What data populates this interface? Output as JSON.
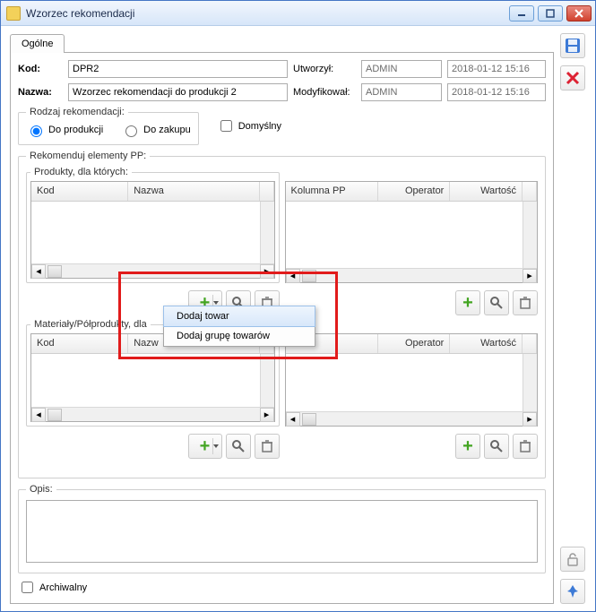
{
  "window": {
    "title": "Wzorzec rekomendacji"
  },
  "tab": {
    "general": "Ogólne"
  },
  "form": {
    "kod_label": "Kod:",
    "kod_value": "DPR2",
    "nazwa_label": "Nazwa:",
    "nazwa_value": "Wzorzec rekomendacji do produkcji 2",
    "utworzyl_label": "Utworzył:",
    "utworzyl_user": "ADMIN",
    "utworzyl_date": "2018-01-12 15:16",
    "modyfikowal_label": "Modyfikował:",
    "modyfikowal_user": "ADMIN",
    "modyfikowal_date": "2018-01-12 15:16"
  },
  "rodzaj": {
    "legend": "Rodzaj rekomendacji:",
    "opt_produkcji": "Do produkcji",
    "opt_zakupu": "Do zakupu",
    "selected": "produkcji",
    "default_label": "Domyślny"
  },
  "rekomenduj": {
    "legend": "Rekomenduj elementy PP:",
    "group1": "Produkty, dla których:",
    "group2": "Materiały/Półprodukty, dla",
    "cols_a": {
      "c1": "Kod",
      "c2": "Nazwa"
    },
    "cols_b": {
      "c1": "Kolumna PP",
      "c2": "Operator",
      "c3": "Wartość"
    }
  },
  "context_menu": {
    "item1": "Dodaj towar",
    "item2": "Dodaj grupę towarów"
  },
  "opis": {
    "label": "Opis:",
    "value": ""
  },
  "footer": {
    "archiwalny": "Archiwalny"
  },
  "icons": {
    "minimize": "minimize-icon",
    "maximize": "maximize-icon",
    "close": "close-icon",
    "save": "save-icon",
    "delete": "delete-icon",
    "unlock": "unlock-icon",
    "pin": "pin-icon",
    "add": "add-icon",
    "search": "search-icon",
    "trash": "trash-icon",
    "dropdown": "chevron-down-icon"
  }
}
